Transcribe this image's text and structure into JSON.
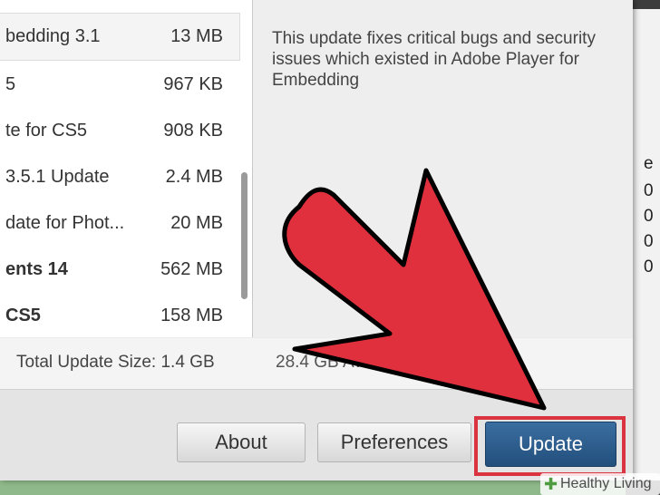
{
  "background_window": {
    "fragments": [
      "e",
      "0",
      "0",
      "0",
      "0"
    ]
  },
  "update_list": [
    {
      "name": "bedding 3.1",
      "size": "13 MB",
      "selected": true,
      "bold": false
    },
    {
      "name": "5",
      "size": "967 KB",
      "selected": false,
      "bold": false
    },
    {
      "name": "te for CS5",
      "size": "908 KB",
      "selected": false,
      "bold": false
    },
    {
      "name": "3.5.1 Update",
      "size": "2.4 MB",
      "selected": false,
      "bold": false
    },
    {
      "name": "date for Phot...",
      "size": "20 MB",
      "selected": false,
      "bold": false
    },
    {
      "name": "ents 14",
      "size": "562 MB",
      "selected": false,
      "bold": true
    },
    {
      "name": "CS5",
      "size": "158 MB",
      "selected": false,
      "bold": true
    }
  ],
  "detail": {
    "description": "This update fixes critical bugs and security issues which existed in Adobe Player for Embedding"
  },
  "summary": {
    "total_label": "Total Update Size: 1.4 GB",
    "free_space": "28.4 GB Ava"
  },
  "buttons": {
    "about": "About",
    "preferences": "Preferences",
    "update": "Update"
  },
  "annotation": {
    "arrow_color": "#e0303d",
    "highlight_color": "#d9343f"
  },
  "watermark": {
    "text": "Healthy Living",
    "icon": "plus-icon"
  }
}
